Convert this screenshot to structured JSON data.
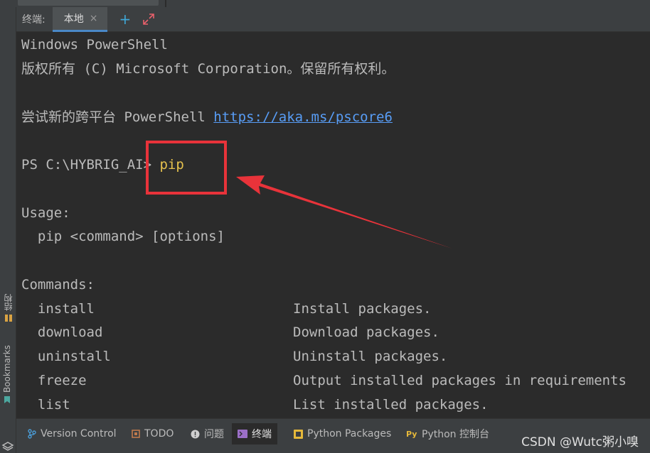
{
  "header": {
    "title": "终端:",
    "tab_label": "本地",
    "close_glyph": "×",
    "new_tab_glyph": "+",
    "expand_glyph": "⤢"
  },
  "terminal": {
    "lines": {
      "l1": "Windows PowerShell",
      "l2": "版权所有 (C) Microsoft Corporation。保留所有权利。",
      "l3_text": "尝试新的跨平台 PowerShell ",
      "l3_link": "https://aka.ms/pscore6",
      "prompt": "PS C:\\HYBRIG_AI> ",
      "command": "pip",
      "usage_title": "Usage:",
      "usage_line": "  pip <command> [options]",
      "commands_title": "Commands:"
    },
    "commands": [
      {
        "name": "install",
        "desc": "Install packages."
      },
      {
        "name": "download",
        "desc": "Download packages."
      },
      {
        "name": "uninstall",
        "desc": "Uninstall packages."
      },
      {
        "name": "freeze",
        "desc": "Output installed packages in requirements"
      },
      {
        "name": "list",
        "desc": "List installed packages."
      }
    ]
  },
  "left_stripe": {
    "structure_label": "结构",
    "bookmarks_label": "Bookmarks"
  },
  "bottom_bar": {
    "version_control": "Version Control",
    "todo": "TODO",
    "problems": "问题",
    "terminal": "终端",
    "python_packages": "Python Packages",
    "python_console": "Python 控制台",
    "watermark": "CSDN @Wutc粥小嗅"
  },
  "colors": {
    "background": "#2b2b2b",
    "panel": "#3c3f41",
    "accent": "#4a88c7",
    "command": "#e5c14d",
    "link": "#589df6",
    "annotation": "#e8333a"
  }
}
